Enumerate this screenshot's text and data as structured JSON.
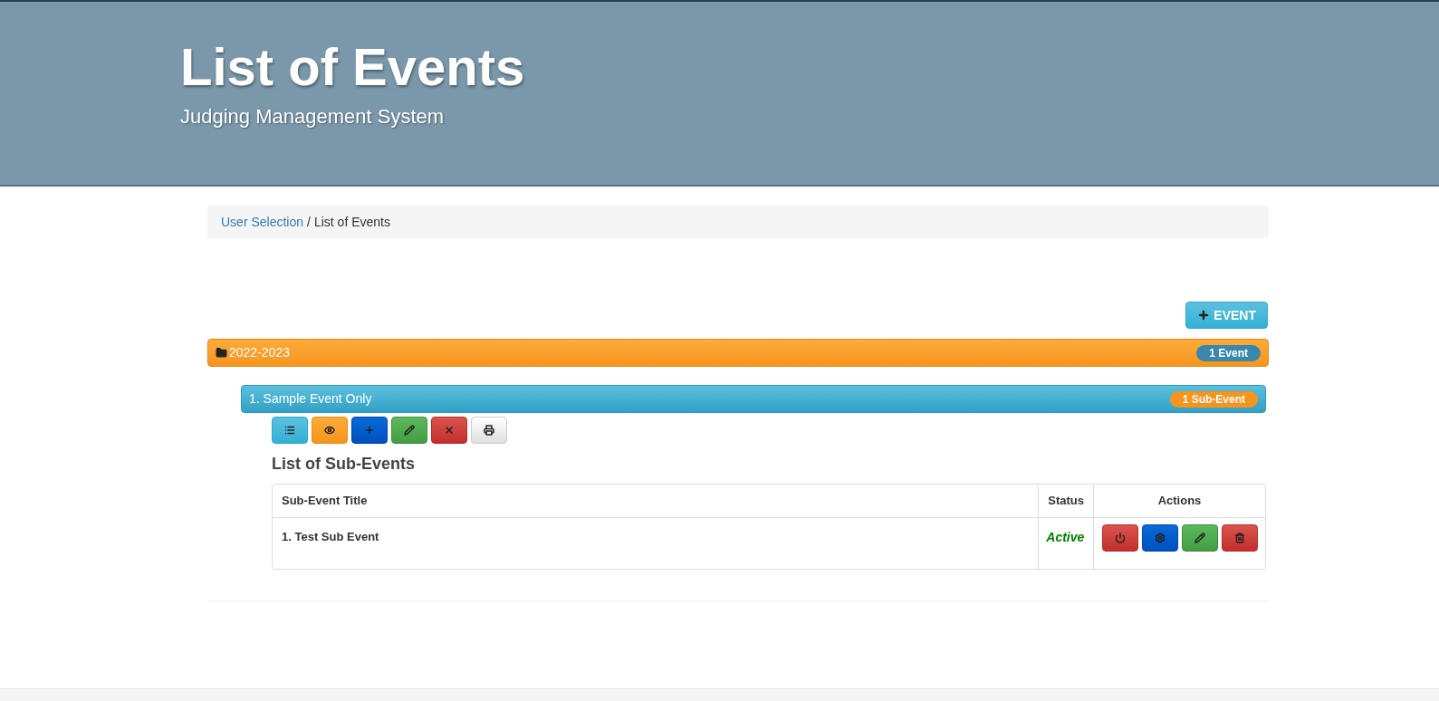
{
  "header": {
    "title": "List of Events",
    "subtitle": "Judging Management System"
  },
  "breadcrumb": {
    "link": "User Selection",
    "separator": "/",
    "current": "List of Events"
  },
  "add_button": {
    "label": "EVENT"
  },
  "folder": {
    "label": "2022-2023",
    "badge": "1 Event",
    "event": {
      "label": "1. Sample Event Only",
      "badge": "1 Sub-Event",
      "toolbar": [
        {
          "kind": "list"
        },
        {
          "kind": "view"
        },
        {
          "kind": "add"
        },
        {
          "kind": "edit"
        },
        {
          "kind": "remove"
        },
        {
          "kind": "print"
        }
      ],
      "heading": "List of Sub-Events",
      "table": {
        "columns": [
          "Sub-Event Title",
          "Status",
          "Actions"
        ],
        "rows": [
          {
            "title": "1. Test Sub Event",
            "status": "Active",
            "actions": [
              {
                "kind": "power"
              },
              {
                "kind": "settings"
              },
              {
                "kind": "edit"
              },
              {
                "kind": "trash"
              }
            ]
          }
        ]
      }
    }
  }
}
